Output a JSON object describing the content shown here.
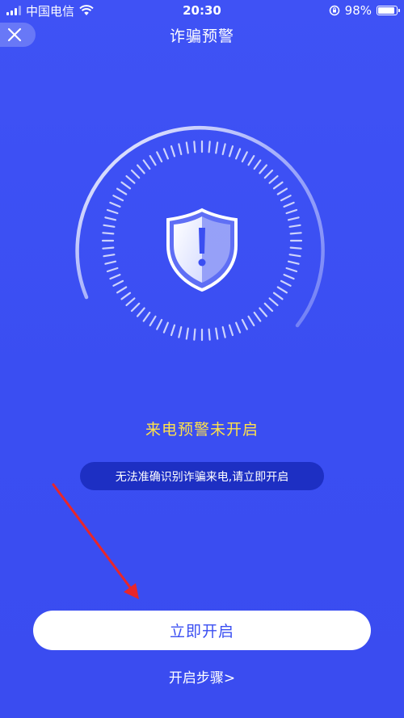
{
  "status_bar": {
    "carrier": "中国电信",
    "time": "20:30",
    "battery": "98%",
    "battery_level": 0.98,
    "icons": [
      "signal-icon",
      "wifi-icon",
      "orientation-lock-icon",
      "battery-icon"
    ]
  },
  "header": {
    "title": "诈骗预警",
    "close_icon": "close-icon"
  },
  "graphic": {
    "icon": "shield-warning-icon",
    "progress_icon": "dial-ring-icon"
  },
  "main": {
    "status": "来电预警未开启",
    "hint": "无法准确识别诈骗来电,请立即开启"
  },
  "actions": {
    "primary_label": "立即开启",
    "steps_label": "开启步骤>"
  },
  "colors": {
    "background": "#3d4ff3",
    "status_text": "#ffe24a",
    "pill": "#1d2fc3",
    "button_bg": "#ffffff",
    "button_text": "#3a4ef2",
    "annotation_arrow": "#e8262a"
  }
}
